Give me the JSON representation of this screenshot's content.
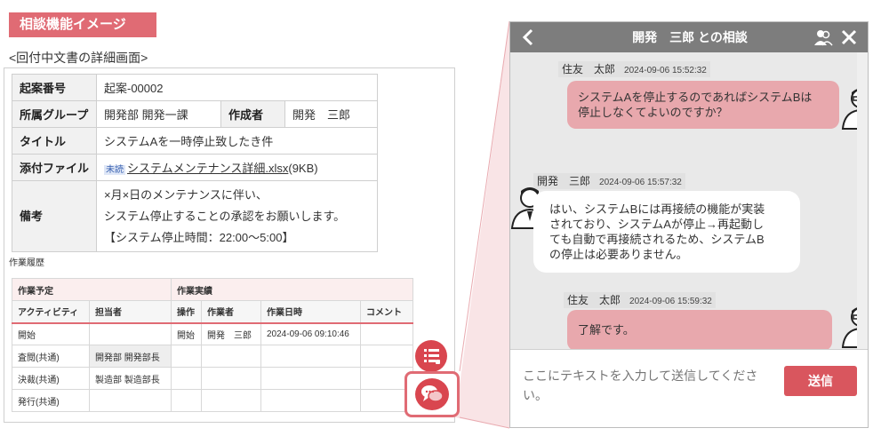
{
  "page": {
    "badge": "相談機能イメージ",
    "subtitle": "<回付中文書の詳細画面>"
  },
  "document": {
    "rows": {
      "proposal_no": {
        "label": "起案番号",
        "value": "起案-00002"
      },
      "group": {
        "label": "所属グループ",
        "value": "開発部 開発一課"
      },
      "creator": {
        "label": "作成者",
        "value": "開発　三郎"
      },
      "title": {
        "label": "タイトル",
        "value": "システムAを一時停止致したき件"
      },
      "attachment": {
        "label": "添付ファイル",
        "badge": "未読",
        "file": "システムメンテナンス詳細.xlsx",
        "size": "(9KB)"
      },
      "remarks": {
        "label": "備考",
        "lines": [
          "×月×日のメンテナンスに伴い、",
          "システム停止することの承認をお願いします。",
          "【システム停止時間：22:00〜5:00】"
        ]
      }
    }
  },
  "history": {
    "label": "作業履歴",
    "groups": {
      "plan": "作業予定",
      "actual": "作業実績"
    },
    "columns": [
      "アクティビティ",
      "担当者",
      "操作",
      "作業者",
      "作業日時",
      "コメント"
    ],
    "rows": [
      {
        "activity": "開始",
        "assignee": "",
        "operation": "開始",
        "worker": "開発　三郎",
        "datetime": "2024-09-06 09:10:46",
        "comment": ""
      },
      {
        "activity": "査閲(共通)",
        "assignee": "開発部 開発部長",
        "operation": "",
        "worker": "",
        "datetime": "",
        "comment": ""
      },
      {
        "activity": "決裁(共通)",
        "assignee": "製造部 製造部長",
        "operation": "",
        "worker": "",
        "datetime": "",
        "comment": ""
      },
      {
        "activity": "発行(共通)",
        "assignee": "",
        "operation": "",
        "worker": "",
        "datetime": "",
        "comment": ""
      }
    ]
  },
  "fabs": {
    "list_icon": "list-icon",
    "chat_icon": "chat-icon"
  },
  "chat": {
    "title": "開発　三郎 との相談",
    "messages": [
      {
        "sender": "住友　太郎",
        "time": "2024-09-06 15:52:32",
        "lines": [
          "システムAを停止するのであればシステムBは",
          "停止しなくてよいのですか？"
        ],
        "side": "right"
      },
      {
        "sender": "開発　三郎",
        "time": "2024-09-06 15:57:32",
        "lines": [
          "はい、システムBには再接続の機能が実装",
          "されており、システムAが停止→再起動し",
          "ても自動で再接続されるため、システムB",
          "の停止は必要ありません。"
        ],
        "side": "left"
      },
      {
        "sender": "住友　太郎",
        "time": "2024-09-06 15:59:32",
        "lines": [
          "了解です。"
        ],
        "side": "right"
      }
    ],
    "input_placeholder": "ここにテキストを入力して送信してください。",
    "send_label": "送信"
  },
  "colors": {
    "accent": "#e06b74",
    "fab": "#d9464f",
    "bubble_pink": "#e8a8ad",
    "header": "#7d7d7d"
  }
}
